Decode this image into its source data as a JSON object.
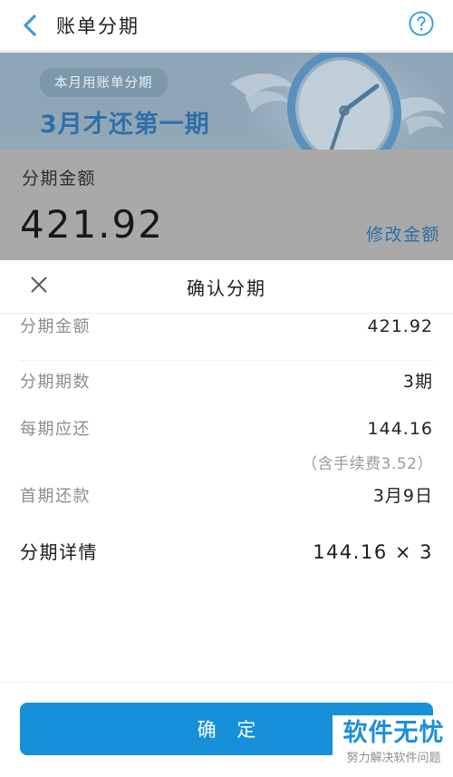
{
  "navbar": {
    "back_icon": "chevron-left-icon",
    "title": "账单分期",
    "help_icon": "help-circle-icon"
  },
  "banner": {
    "badge": "本月用账单分期",
    "headline": "3月才还第一期",
    "art_icon": "clock-illustration"
  },
  "amount_panel": {
    "label": "分期金额",
    "value": "421.92",
    "edit_link": "修改金额"
  },
  "sheet": {
    "close_icon": "close-icon",
    "title": "确认分期",
    "rows": [
      {
        "key": "分期金额",
        "value": "421.92"
      },
      {
        "key": "分期期数",
        "value": "3期"
      },
      {
        "key": "每期应还",
        "value": "144.16",
        "note": "（含手续费3.52）"
      },
      {
        "key": "首期还款",
        "value": "3月9日"
      },
      {
        "key": "分期详情",
        "value": "144.16 × 3"
      }
    ],
    "confirm_label": "确 定"
  },
  "watermark": {
    "main": "软件无忧",
    "sub": "努力解决软件问题"
  },
  "colors": {
    "accent_blue": "#1690d8",
    "link_blue": "#2c6ea8",
    "nav_icon_blue": "#3a9ed6",
    "banner_bg": "#8ea5b6",
    "dim_gray": "#a9a9a9",
    "headline_blue": "#2f6fa8"
  }
}
